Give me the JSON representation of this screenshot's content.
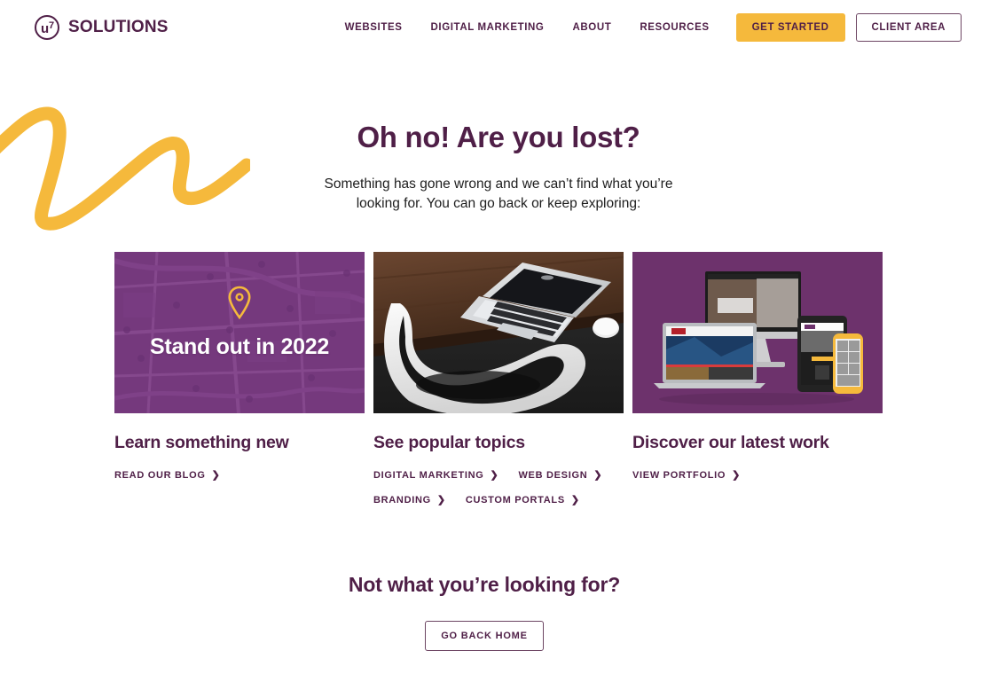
{
  "brand": {
    "mark_label": "u7",
    "name": "SOLUTIONS"
  },
  "nav": {
    "links": [
      {
        "label": "WEBSITES"
      },
      {
        "label": "DIGITAL MARKETING"
      },
      {
        "label": "ABOUT"
      },
      {
        "label": "RESOURCES"
      }
    ],
    "primary_button": "GET STARTED",
    "outline_button": "CLIENT AREA"
  },
  "hero": {
    "title": "Oh no! Are you lost?",
    "subtitle": "Something has gone wrong and we can’t find what you’re looking for. You can go back or keep exploring:"
  },
  "cards": [
    {
      "media_caption": "Stand out in 2022",
      "title": "Learn something new",
      "links": [
        {
          "label": "READ OUR BLOG"
        }
      ]
    },
    {
      "media_caption": "",
      "title": "See popular topics",
      "links": [
        {
          "label": "DIGITAL MARKETING"
        },
        {
          "label": "WEB DESIGN"
        },
        {
          "label": "BRANDING"
        },
        {
          "label": "CUSTOM PORTALS"
        }
      ]
    },
    {
      "media_caption": "",
      "title": "Discover our latest work",
      "links": [
        {
          "label": "VIEW PORTFOLIO"
        }
      ]
    }
  ],
  "cta": {
    "title": "Not what you’re looking for?",
    "button": "GO BACK HOME"
  },
  "colors": {
    "purple": "#4F1F47",
    "yellow": "#F5B93C",
    "map_purple": "#9B5CA0",
    "card_purple": "#6D326C"
  },
  "chevron_glyph": "❯"
}
